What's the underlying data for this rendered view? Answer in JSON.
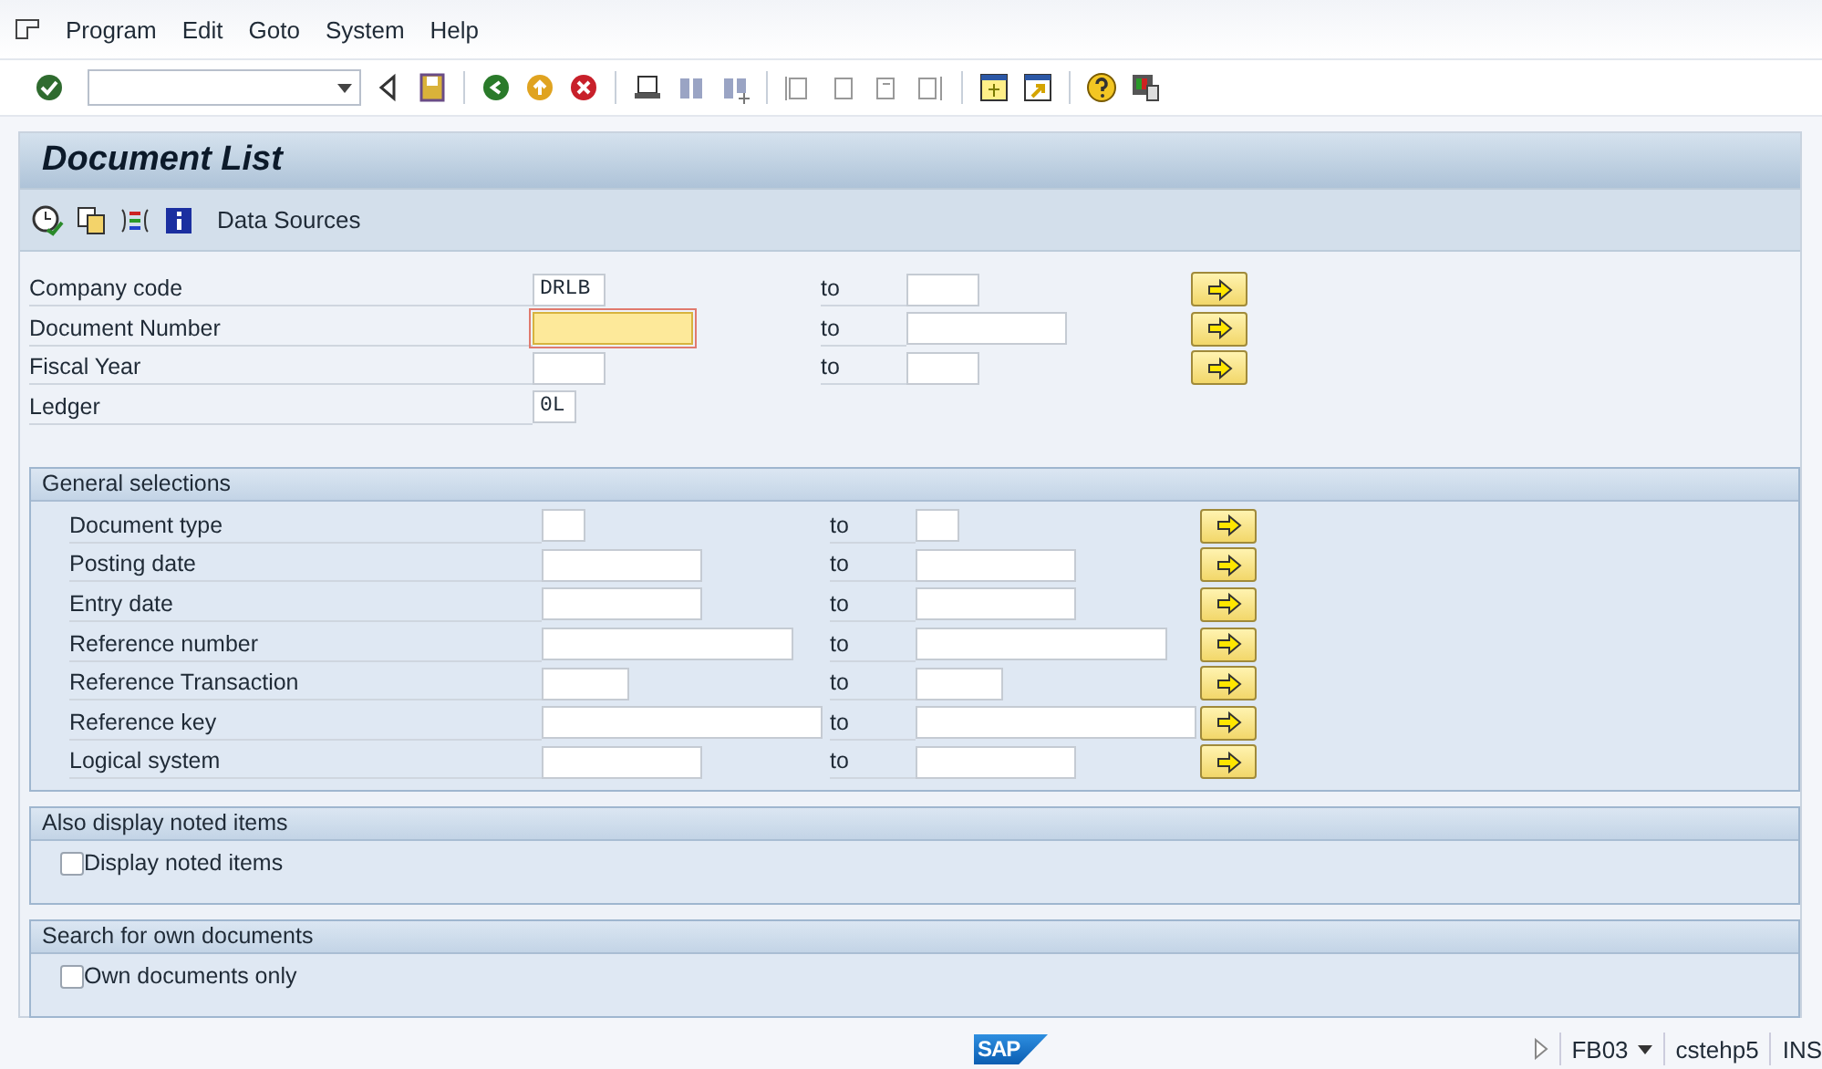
{
  "menu": [
    {
      "label": "Program"
    },
    {
      "label": "Edit"
    },
    {
      "label": "Goto"
    },
    {
      "label": "System"
    },
    {
      "label": "Help"
    }
  ],
  "title": "Document List",
  "app_toolbar": {
    "button": "Data Sources"
  },
  "main_fields": [
    {
      "label": "Company code",
      "low": "DRLB",
      "focused": false,
      "to": "to"
    },
    {
      "label": "Document Number",
      "focused": true,
      "to": "to"
    },
    {
      "label": "Fiscal Year",
      "focused": false,
      "to": "to"
    },
    {
      "label": "Ledger",
      "low": "0L",
      "focused": false
    }
  ],
  "general_selections": {
    "title": "General selections",
    "fields": [
      {
        "label": "Document type",
        "to": "to"
      },
      {
        "label": "Posting date",
        "to": "to"
      },
      {
        "label": "Entry date",
        "to": "to"
      },
      {
        "label": "Reference number",
        "to": "to"
      },
      {
        "label": "Reference Transaction",
        "to": "to"
      },
      {
        "label": "Reference key",
        "to": "to"
      },
      {
        "label": "Logical system",
        "to": "to"
      }
    ]
  },
  "option_groups": [
    {
      "title": "Also display noted items",
      "checkbox": {
        "label": "Display noted items",
        "checked": false
      }
    },
    {
      "title": "Search for own documents",
      "checkbox": {
        "label": "Own documents only",
        "checked": false
      }
    }
  ],
  "status_bar": {
    "logo": "SAP",
    "transaction": "FB03",
    "user": "cstehp5",
    "mode": "INS"
  }
}
